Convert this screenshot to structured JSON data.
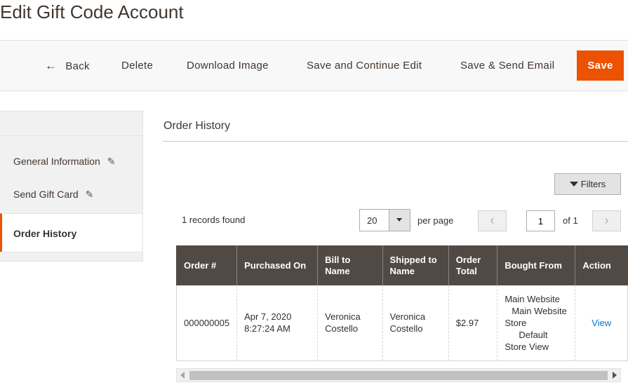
{
  "page": {
    "title": "Edit Gift Code Account"
  },
  "toolbar": {
    "back_label": "Back",
    "delete_label": "Delete",
    "download_label": "Download Image",
    "save_continue_label": "Save and Continue Edit",
    "save_send_label": "Save & Send Email",
    "save_label": "Save",
    "accent_color": "#eb5202"
  },
  "sidebar": {
    "items": [
      {
        "label": "General Information",
        "icon": "pencil-icon"
      },
      {
        "label": "Send Gift Card",
        "icon": "pencil-icon"
      },
      {
        "label": "Order History",
        "active": true
      }
    ]
  },
  "section": {
    "title": "Order History"
  },
  "grid_controls": {
    "filters_label": "Filters",
    "records_found": "1 records found",
    "per_page_value": "20",
    "per_page_label": "per page",
    "current_page": "1",
    "of_pages": "of 1"
  },
  "table": {
    "headers": [
      "Order #",
      "Purchased On",
      "Bill to Name",
      "Shipped to Name",
      "Order Total",
      "Bought From",
      "Action"
    ],
    "rows": [
      {
        "order": "000000005",
        "purchased_date": "Apr 7, 2020",
        "purchased_time": "8:27:24 AM",
        "bill_first": "Veronica",
        "bill_last": "Costello",
        "ship_first": "Veronica",
        "ship_last": "Costello",
        "total": "$2.97",
        "bought_website": "Main Website",
        "bought_store_1": "Main Website",
        "bought_store_2": "Store",
        "bought_view_1": "Default",
        "bought_view_2": "Store View",
        "action": "View"
      }
    ]
  }
}
